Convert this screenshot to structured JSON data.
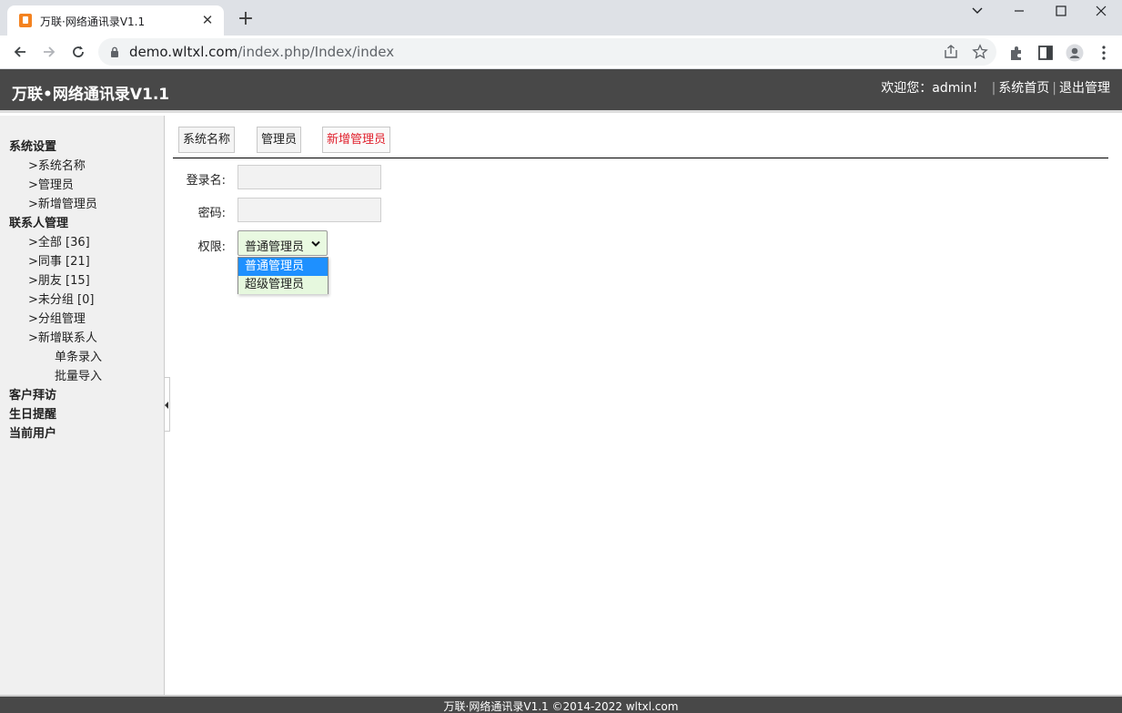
{
  "browser": {
    "tab_title": "万联·网络通讯录V1.1",
    "tab_close": "✕",
    "new_tab": "+",
    "url_host": "demo.wltxl.com",
    "url_path": "/index.php/Index/index"
  },
  "header": {
    "title": "万联•网络通讯录V1.1",
    "welcome": "欢迎您：admin！",
    "separator": "|",
    "home_link": "系统首页",
    "logout_link": "退出管理"
  },
  "sidebar": {
    "groups": [
      {
        "label": "系统设置"
      },
      {
        "label": "联系人管理"
      },
      {
        "label": "客户拜访"
      },
      {
        "label": "生日提醒"
      },
      {
        "label": "当前用户"
      }
    ],
    "system_items": [
      ">系统名称",
      ">管理员",
      ">新增管理员"
    ],
    "contact_items": [
      ">全部 [36]",
      ">同事 [21]",
      ">朋友 [15]",
      ">未分组 [0]",
      ">分组管理",
      ">新增联系人"
    ],
    "new_contact_subitems": [
      "单条录入",
      "批量导入"
    ]
  },
  "main": {
    "tabs": [
      {
        "label": "系统名称"
      },
      {
        "label": "管理员"
      },
      {
        "label": "新增管理员"
      }
    ],
    "form": {
      "login_label": "登录名:",
      "login_value": "",
      "password_label": "密码:",
      "password_value": "",
      "permission_label": "权限:",
      "permission_selected": "普通管理员",
      "permission_options": [
        "普通管理员",
        "超级管理员"
      ]
    }
  },
  "footer": {
    "text": "万联·网络通讯录V1.1 ©2014-2022 wltxl.com"
  },
  "colors": {
    "header_bg": "#484848",
    "active_tab_text": "#e0202c",
    "dropdown_highlight": "#1e90ff",
    "select_bg": "#e9f9e1"
  }
}
